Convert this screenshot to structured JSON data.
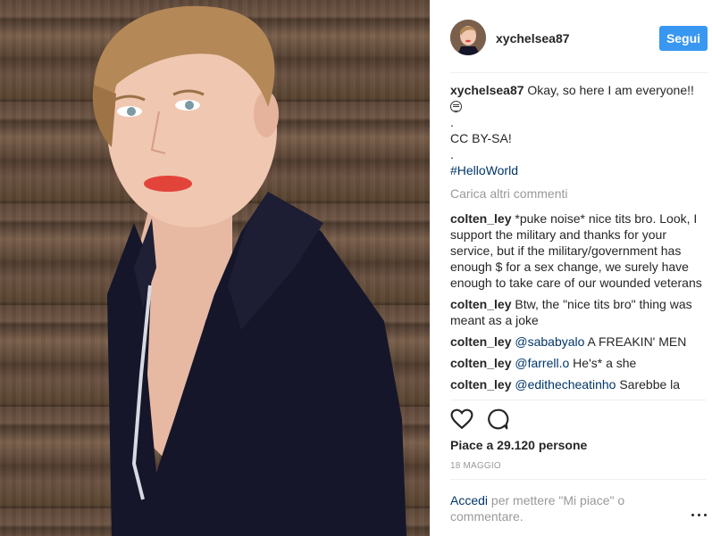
{
  "post": {
    "username": "xychelsea87",
    "follow_label": "Segui",
    "caption": {
      "username": "xychelsea87",
      "text": "Okay, so here I am everyone!!",
      "emoji": "grinning-face-emoji",
      "dot1": ".",
      "line2": "CC BY-SA!",
      "dot2": ".",
      "hashtag": "#HelloWorld"
    },
    "load_more": "Carica altri commenti",
    "comments": [
      {
        "user": "colten_ley",
        "text": "*puke noise* nice tits bro. Look, I support the military and thanks for your service, but if the military/government has enough $ for a sex change, we surely have enough to take care of our wounded veterans"
      },
      {
        "user": "colten_ley",
        "text": "Btw, the \"nice tits bro\" thing was meant as a joke"
      },
      {
        "user": "colten_ley",
        "mention": "@sababyalo",
        "text": "A FREAKIN' MEN"
      },
      {
        "user": "colten_ley",
        "mention": "@farrell.o",
        "text": "He's* a she"
      },
      {
        "user": "colten_ley",
        "mention": "@edithecheatinho",
        "text": "Sarebbe la"
      }
    ],
    "likes": "Piace a 29.120 persone",
    "date": "18 MAGGIO",
    "login_prompt": {
      "link": "Accedi",
      "text": "per mettere \"Mi piace\" o commentare."
    },
    "icons": {
      "like": "heart-icon",
      "comment": "comment-icon",
      "more": "more-options-icon"
    },
    "colors": {
      "accent": "#3897f0",
      "link": "#003569",
      "muted": "#999999",
      "text": "#262626"
    }
  }
}
